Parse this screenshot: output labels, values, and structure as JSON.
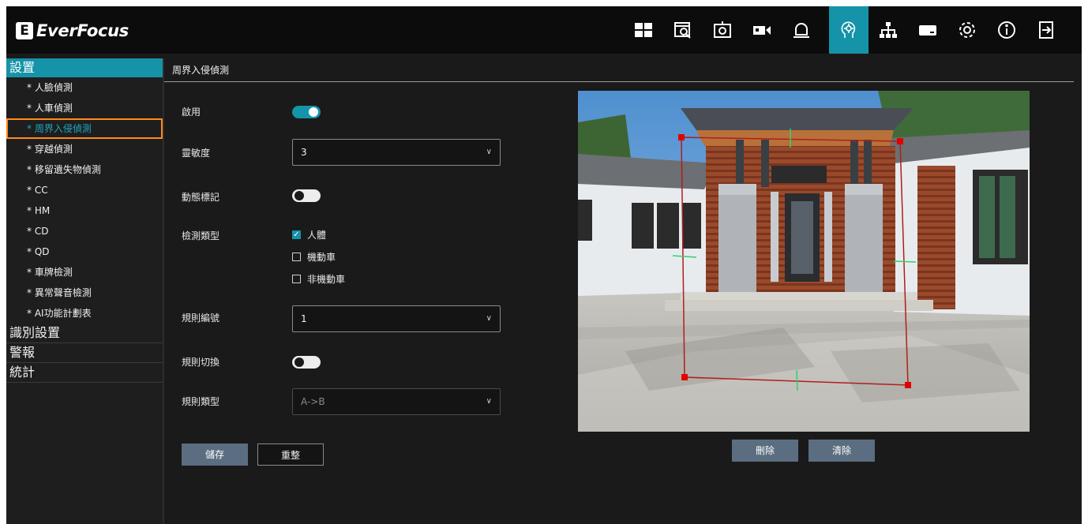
{
  "brand": {
    "name": "EverFocus",
    "mark": "E"
  },
  "topbar": {
    "icons": [
      "layout-icon",
      "playback-icon",
      "snapshot-icon",
      "camera-icon",
      "alarm-bell-icon",
      "ai-head-icon",
      "network-icon",
      "storage-icon",
      "gear-icon",
      "info-icon",
      "logout-icon"
    ],
    "active_icon": "ai-head-icon",
    "accent_color": "#1593a8"
  },
  "sidebar": {
    "sections": [
      {
        "label": "設置",
        "active": true
      },
      {
        "label": "識別設置"
      },
      {
        "label": "警報"
      },
      {
        "label": "統計"
      }
    ],
    "items": [
      "* 人臉偵測",
      "* 人車偵測",
      "* 周界入侵偵測",
      "* 穿越偵測",
      "* 移留遺失物偵測",
      "* CC",
      "* HM",
      "* CD",
      "* QD",
      "* 車牌檢測",
      "* 異常聲音檢測",
      "* AI功能計劃表"
    ],
    "selected_item": "* 周界入侵偵測",
    "selection_color": "#ff8a1e"
  },
  "page": {
    "title": "周界入侵偵測",
    "enable": {
      "label": "啟用",
      "on": true
    },
    "sensitivity": {
      "label": "靈敏度",
      "value": "3"
    },
    "motion_mark": {
      "label": "動態標記",
      "on": false
    },
    "detect_type": {
      "label": "檢測類型",
      "options": [
        {
          "label": "人體",
          "checked": true
        },
        {
          "label": "機動車",
          "checked": false
        },
        {
          "label": "非機動車",
          "checked": false
        }
      ]
    },
    "rule_no": {
      "label": "規則編號",
      "value": "1"
    },
    "rule_switch": {
      "label": "規則切換",
      "on": false
    },
    "rule_type": {
      "label": "規則類型",
      "value": "A->B"
    },
    "save_label": "儲存",
    "reset_label": "重整",
    "delete_label": "刪除",
    "clear_label": "清除"
  }
}
